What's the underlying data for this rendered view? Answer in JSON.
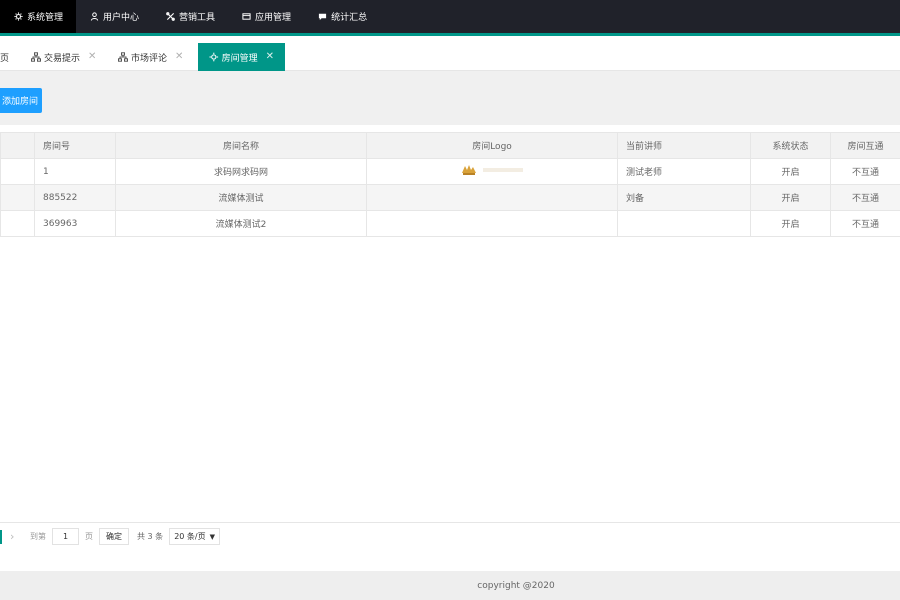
{
  "topnav": {
    "items": [
      {
        "label": "系统管理",
        "icon": "gear-icon",
        "active": true
      },
      {
        "label": "用户中心",
        "icon": "user-icon",
        "active": false
      },
      {
        "label": "营销工具",
        "icon": "tools-icon",
        "active": false
      },
      {
        "label": "应用管理",
        "icon": "app-icon",
        "active": false
      },
      {
        "label": "统计汇总",
        "icon": "chat-icon",
        "active": false
      }
    ],
    "accent_color": "#009688",
    "background": "#20222a"
  },
  "tabs": [
    {
      "label": "首页",
      "closable": false,
      "active": false
    },
    {
      "label": "交易提示",
      "closable": true,
      "active": false
    },
    {
      "label": "市场评论",
      "closable": true,
      "active": false
    },
    {
      "label": "房间管理",
      "closable": true,
      "active": true
    }
  ],
  "toolbar": {
    "add_label": "添加房间",
    "add_color": "#1e9fff"
  },
  "table": {
    "columns": [
      "",
      "房间号",
      "房间名称",
      "房间Logo",
      "当前讲师",
      "系统状态",
      "房间互通"
    ],
    "rows": [
      {
        "room_no": "1",
        "name": "求码网求码网",
        "logo": "logo-image",
        "teacher": "测试老师",
        "status": "开启",
        "interop": "不互通"
      },
      {
        "room_no": "885522",
        "name": "流媒体测试",
        "logo": "",
        "teacher": "刘备",
        "status": "开启",
        "interop": "不互通"
      },
      {
        "room_no": "369963",
        "name": "流媒体测试2",
        "logo": "",
        "teacher": "",
        "status": "开启",
        "interop": "不互通"
      }
    ]
  },
  "pager": {
    "goto_label": "到第",
    "page_value": "1",
    "page_unit": "页",
    "confirm_label": "确定",
    "total_text": "共 3 条",
    "page_size": "20 条/页"
  },
  "footer": {
    "text": "copyright @2020"
  }
}
